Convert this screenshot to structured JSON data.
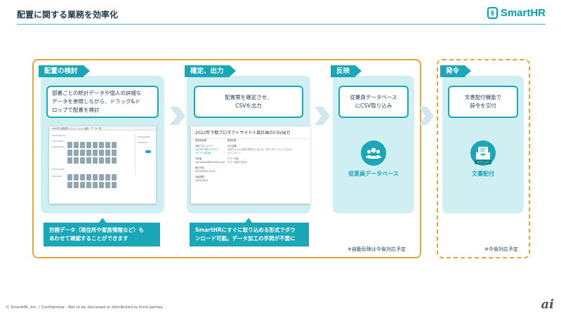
{
  "header": {
    "title": "配置に関する業務を効率化",
    "logo_text": "SmartHR",
    "logo_mark": "§"
  },
  "stages": [
    {
      "label": "配置の検討",
      "callout": "部署ごとの統計データや個人の詳細な\nデータを参照しながら、ドラッグ&ド\nロップで配置を検討",
      "note": "労務データ（現住所や家族情報など）も\nあわせて確認することができます"
    },
    {
      "label": "確定、出力",
      "callout": "配置案を確定させ、\nCSVを出力",
      "note": "SmartHRにすぐに取り込める形式でダウ\nンロード可能。データ加工の手間が不要に",
      "screenshot": {
        "title": "2022年下期プロダクトサイド人員計画のCSV出力",
        "col1_header": "配置案情報",
        "col2_header": "配置結果",
        "col1_items": [
          "対象プロジェクト",
          "2022年下期プロダクト",
          "サイド人員計画",
          "作成者",
          "xxx.xxxxxx@smarthr.co.jp",
          "期日作成",
          "2022/09/20 15:00",
          "対象期限",
          "2022/10/01"
        ],
        "col2_items": [
          "出力結果",
          "CSVファイルの出力が完了しました。ダウンロードしてください",
          "ダウンロード",
          "エラー内容",
          "エラーはありません"
        ]
      }
    },
    {
      "label": "反映",
      "callout": "従業員データベース\nにCSV取り込み",
      "icon_caption": "従業員データベース"
    },
    {
      "label": "発令",
      "callout": "文書配付機能で\n辞令を交付",
      "icon_caption": "文書配付",
      "icon_badge": "オプション"
    }
  ],
  "notes": {
    "auto_reflect": "※自動反映は今後対応予定",
    "future": "※今後対応予定"
  },
  "screenshot1": {
    "title": "2022年上期配置シミュレーション検討　データ一覧"
  },
  "footer": {
    "copyright": "© SmartHR, Inc. / Confidential - Not to be disclosed or distributed to third parties.",
    "watermark": "ai"
  },
  "colors": {
    "accent": "#1aa7b8",
    "panel": "#cfeff3",
    "frame": "#e9a334",
    "text": "#1f3b4d"
  }
}
